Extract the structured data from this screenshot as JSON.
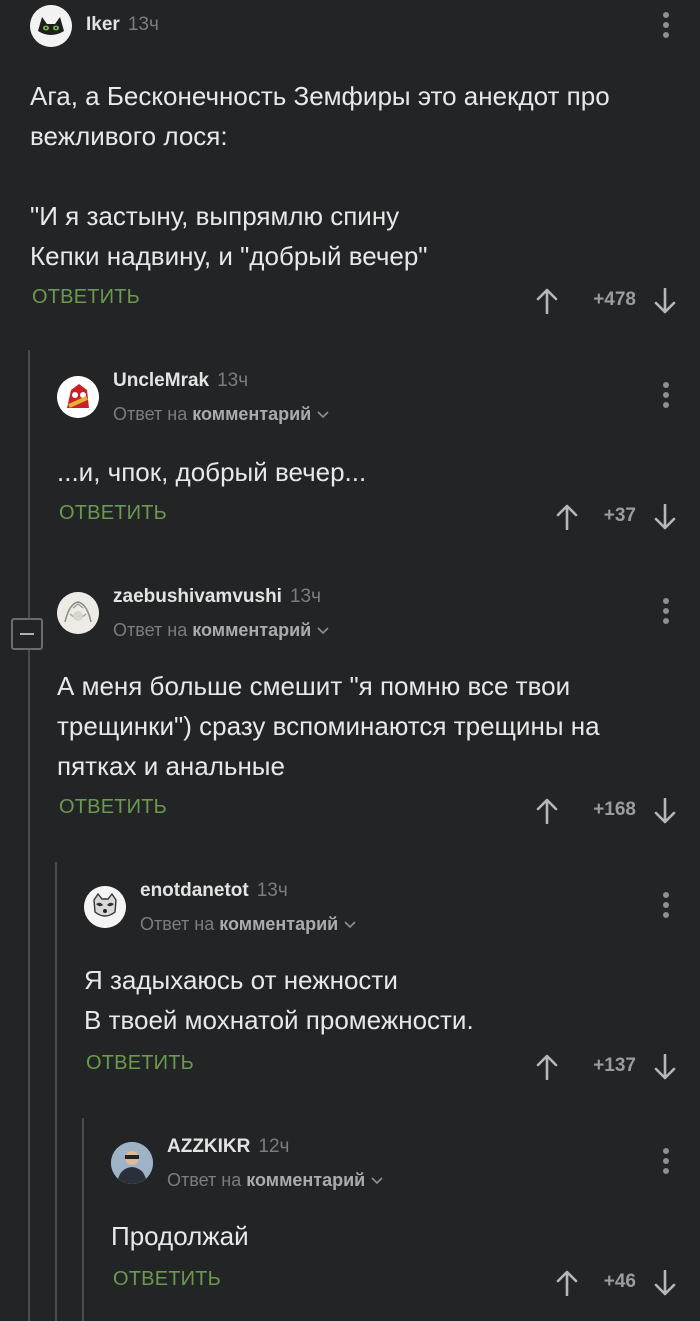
{
  "comments": [
    {
      "author": "Iker",
      "time": "13ч",
      "reply_prefix": "",
      "reply_target": "",
      "text": "Ага, а Бесконечность Земфиры это анекдот про\nвежливого лося:\n\n\"И я застыну, выпрямлю спину\nКепки надвину, и \"добрый вечер\"",
      "reply_label": "ОТВЕТИТЬ",
      "score": "+478",
      "avatar_icon": "cat-avatar-icon"
    },
    {
      "author": "UncleMrak",
      "time": "13ч",
      "reply_prefix": "Ответ на ",
      "reply_target": "комментарий",
      "text": "...и, чпок, добрый вечер...",
      "reply_label": "ОТВЕТИТЬ",
      "score": "+37",
      "avatar_icon": "red-cartoon-avatar-icon"
    },
    {
      "author": "zaebushivamvushi",
      "time": "13ч",
      "reply_prefix": "Ответ на ",
      "reply_target": "комментарий",
      "text": "А меня больше смешит \"я помню все твои\nтрещинки\") сразу вспоминаются трещины на\nпятках и анальные",
      "reply_label": "ОТВЕТИТЬ",
      "score": "+168",
      "avatar_icon": "sketch-avatar-icon"
    },
    {
      "author": "enotdanetot",
      "time": "13ч",
      "reply_prefix": "Ответ на ",
      "reply_target": "комментарий",
      "text": "Я задыхаюсь от нежности\nВ твоей мохнатой промежности.",
      "reply_label": "ОТВЕТИТЬ",
      "score": "+137",
      "avatar_icon": "raccoon-avatar-icon"
    },
    {
      "author": "AZZKIKR",
      "time": "12ч",
      "reply_prefix": "Ответ на ",
      "reply_target": "комментарий",
      "text": "Продолжай",
      "reply_label": "ОТВЕТИТЬ",
      "score": "+46",
      "avatar_icon": "photo-avatar-icon"
    }
  ],
  "colors": {
    "background": "#222426",
    "reply_green": "#6b9a4e",
    "thread_line": "#4a4c4f",
    "muted": "#7b7d80"
  }
}
